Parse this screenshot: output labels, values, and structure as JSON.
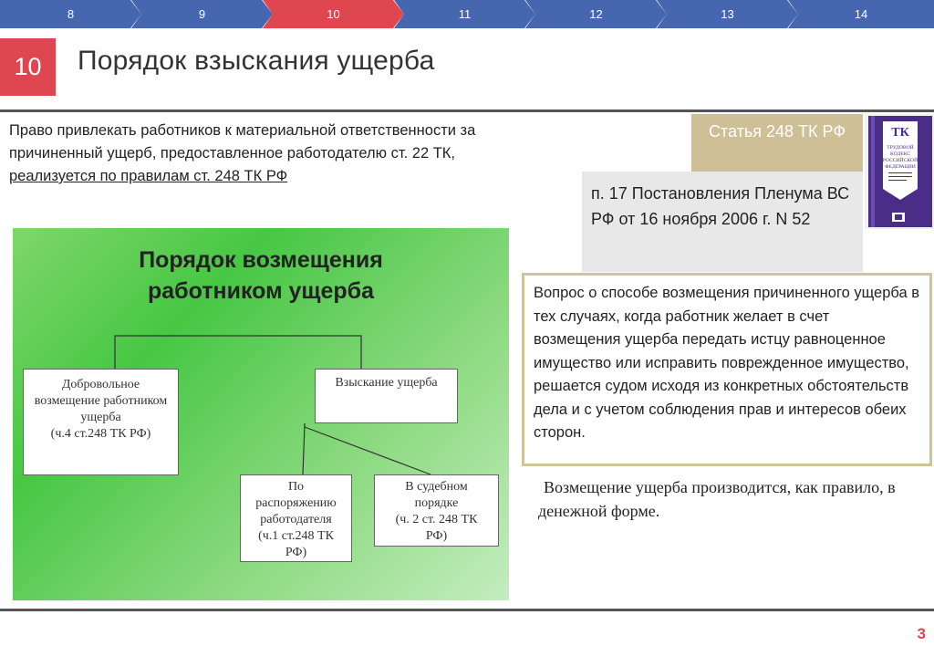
{
  "nav": {
    "tabs": [
      {
        "label": "8",
        "active": false
      },
      {
        "label": "9",
        "active": false
      },
      {
        "label": "10",
        "active": true
      },
      {
        "label": "11",
        "active": false
      },
      {
        "label": "12",
        "active": false
      },
      {
        "label": "13",
        "active": false
      },
      {
        "label": "14",
        "active": false
      }
    ],
    "colors": {
      "tab": "#4667b0",
      "active_tab": "#e0464f"
    }
  },
  "header": {
    "badge": "10",
    "title": "Порядок взыскания ущерба"
  },
  "intro": {
    "line1": "Право привлекать работников к материальной ответственности за",
    "line2": "причиненный ущерб, предоставленное работодателю ст. 22 ТК,",
    "line3": "реализуется по правилам ст. 248 ТК РФ"
  },
  "article": {
    "label": "Статья 248 ТК РФ",
    "book_icon": "labor-code-book-icon",
    "book_title": "ТК",
    "book_text": "ТРУДОВОЙ КОДЕКС РОССИЙСКОЙ ФЕДЕРАЦИИ"
  },
  "plenum": {
    "text": "п. 17 Постановления Пленума ВС РФ от 16 ноября 2006 г. N 52"
  },
  "question": {
    "text": "Вопрос о способе возмещения причиненного ущерба в тех случаях, когда работник желает в счет возмещения ущерба передать истцу равноценное имущество или исправить поврежденное имущество, решается судом исходя из конкретных обстоятельств дела и с учетом соблюдения прав и интересов обеих сторон."
  },
  "money_note": {
    "text": "Возмещение ущерба производится, как правило, в денежной форме."
  },
  "diagram": {
    "title_line1": "Порядок возмещения",
    "title_line2": "работником ущерба",
    "voluntary": {
      "line1": "Добровольное",
      "line2": "возмещение работником",
      "line3": "ущерба",
      "line4": "(ч.4 ст.248 ТК РФ)"
    },
    "recovery": "Взыскание ущерба",
    "employer": {
      "line1": "По",
      "line2": "распоряжению",
      "line3": "работодателя",
      "line4": "(ч.1 ст.248 ТК",
      "line5": "РФ)"
    },
    "court": {
      "line1": "В судебном",
      "line2": "порядке",
      "line3": "(ч. 2 ст. 248 ТК",
      "line4": "РФ)"
    }
  },
  "footer": {
    "page": "3"
  },
  "colors": {
    "accent": "#e0464f",
    "article_bg": "#cfbf96",
    "question_border": "#d2c29b",
    "plenum_bg": "#e8e8e8",
    "diagram_green": "#47c744"
  }
}
